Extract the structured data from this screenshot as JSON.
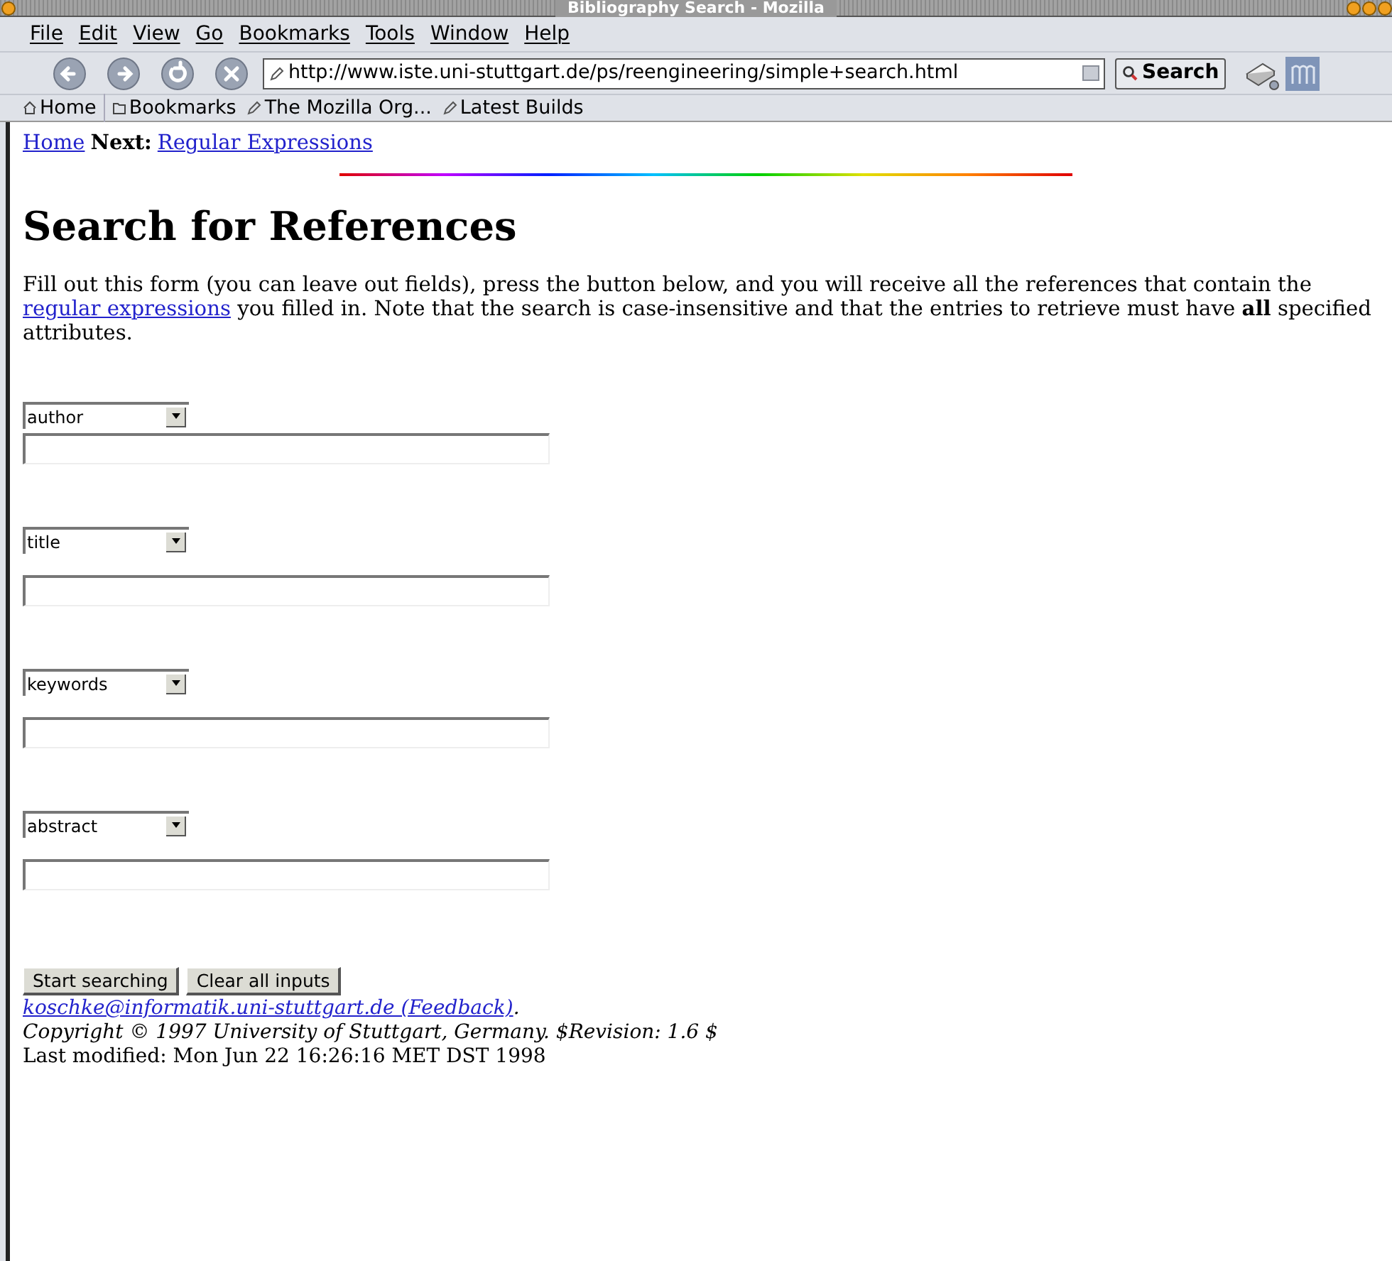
{
  "window": {
    "title": "Bibliography Search - Mozilla"
  },
  "menu": [
    "File",
    "Edit",
    "View",
    "Go",
    "Bookmarks",
    "Tools",
    "Window",
    "Help"
  ],
  "navigation": {
    "url": "http://www.iste.uni-stuttgart.de/ps/reengineering/simple+search.html",
    "search_button": "Search"
  },
  "bookmarks": [
    {
      "kind": "home",
      "label": "Home"
    },
    {
      "kind": "folder",
      "label": "Bookmarks"
    },
    {
      "kind": "link",
      "label": "The Mozilla Org..."
    },
    {
      "kind": "link",
      "label": "Latest Builds"
    }
  ],
  "breadcrumb": {
    "home": "Home",
    "next_label": "Next:",
    "next_link": "Regular Expressions"
  },
  "heading": "Search for References",
  "intro": {
    "before": "Fill out this form (you can leave out fields), press the button below, and you will receive all the references that contain the",
    "link": "regular expressions",
    "after": "you filled in. Note that the search is case-insensitive and that the entries to retrieve must have **all** specified attributes."
  },
  "fields": [
    {
      "attribute": "author"
    },
    {
      "attribute": "title"
    },
    {
      "attribute": "keywords"
    },
    {
      "attribute": "abstract"
    }
  ],
  "buttons": [
    "Start searching",
    "Clear all inputs"
  ],
  "footer": {
    "email": "koschke@informatik.uni-stuttgart.de (Feedback)",
    "period": ".",
    "copyright": "Copyright © 1997 University of Stuttgart, Germany. $Revision: 1.6 $",
    "modified": "Last modified: Mon Jun 22 16:26:16 MET DST 1998"
  }
}
